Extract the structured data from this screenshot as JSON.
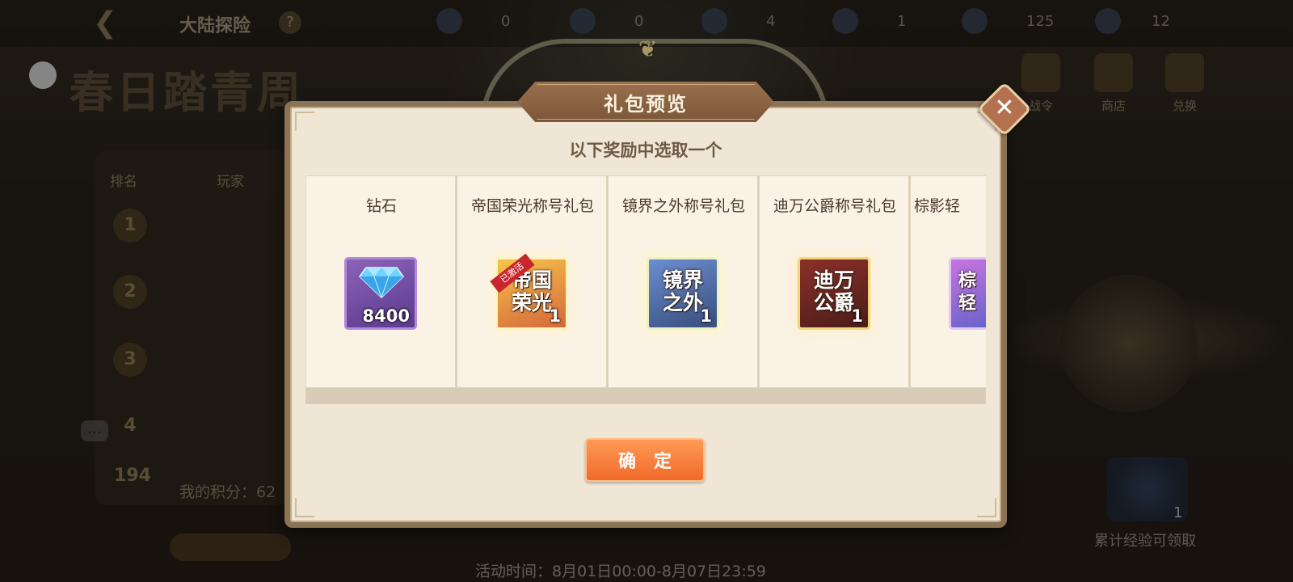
{
  "background": {
    "title": "大陆探险",
    "help_icon": "?",
    "resources": [
      "0",
      "0",
      "4",
      "1",
      "125",
      "12"
    ],
    "event_banner": "春日踏青周",
    "side_buttons": [
      "战令",
      "商店",
      "兑换"
    ],
    "rank_headers": [
      "排名",
      "玩家"
    ],
    "rank_numbers": [
      "1",
      "2",
      "3",
      "4",
      "194"
    ],
    "my_score_label": "我的积分：62",
    "event_time": "活动时间：8月01日00:00-8月07日23:59",
    "exp_count": "1",
    "exp_label": "累计经验可领取"
  },
  "dialog": {
    "title": "礼包预览",
    "subtitle": "以下奖励中选取一个",
    "close_icon": "✕",
    "confirm_label": "确定",
    "items": [
      {
        "name": "钻石",
        "art": "",
        "qty": "8400",
        "color": "purple",
        "icon": "diamond-icon"
      },
      {
        "name": "帝国荣光称号礼包",
        "art": "帝国荣光",
        "qty": "1",
        "color": "gold",
        "badge": "已激活",
        "icon": "title-badge-icon"
      },
      {
        "name": "镜界之外称号礼包",
        "art": "镜界之外",
        "qty": "1",
        "color": "blue",
        "icon": "title-badge-icon"
      },
      {
        "name": "迪万公爵称号礼包",
        "art": "迪万公爵",
        "qty": "1",
        "color": "red",
        "icon": "title-badge-icon"
      },
      {
        "name": "棕影轻",
        "art": "棕轻",
        "qty": "",
        "color": "pink",
        "icon": "title-badge-icon"
      }
    ]
  },
  "colors": {
    "dialog_bg": "#f0e6d6",
    "title_plate": "#8a6448",
    "confirm_button": "#f47a35",
    "card_bg": "#faf2e5"
  }
}
